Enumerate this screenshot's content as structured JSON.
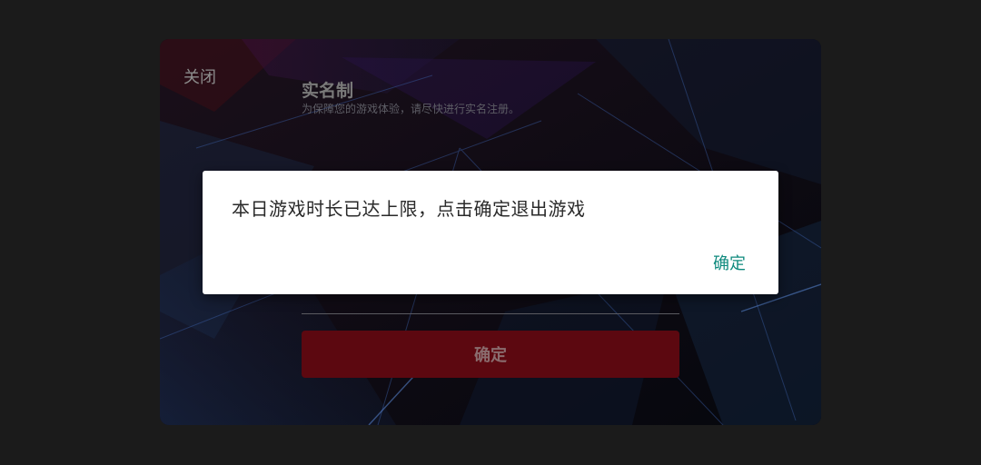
{
  "panel": {
    "close_label": "关闭",
    "title": "实名制",
    "subtitle": "为保障您的游戏体验，请尽快进行实名注册。",
    "confirm_label": "确定"
  },
  "dialog": {
    "message": "本日游戏时长已达上限，点击确定退出游戏",
    "ok_label": "确定"
  },
  "colors": {
    "page_background": "#1b1b1b",
    "panel_background": "#0a0b12",
    "panel_confirm_background": "#5c0810",
    "dialog_background": "#ffffff",
    "dialog_ok_text": "#0f8a7e"
  }
}
